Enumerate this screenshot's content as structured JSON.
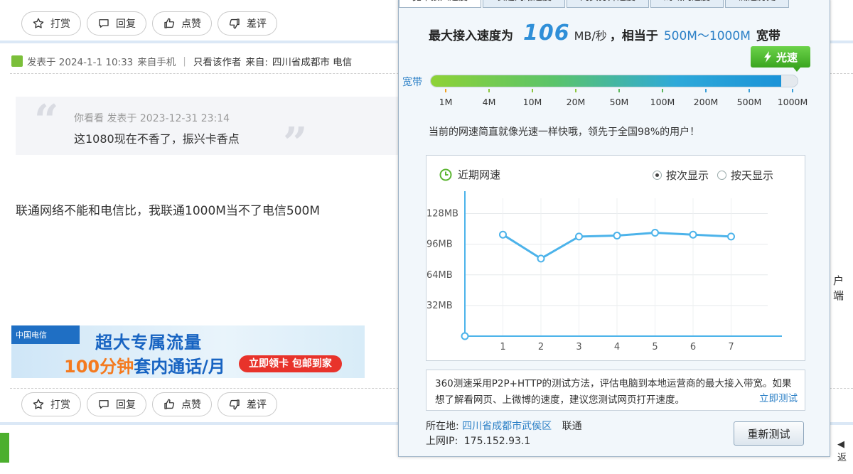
{
  "forum": {
    "action_buttons": [
      {
        "label": "打赏",
        "icon": "star-icon"
      },
      {
        "label": "回复",
        "icon": "comment-icon"
      },
      {
        "label": "点赞",
        "icon": "thumbs-up-icon"
      },
      {
        "label": "差评",
        "icon": "thumbs-down-icon"
      }
    ],
    "post_meta": {
      "posted_at": "发表于 2024-1-1 10:33",
      "from": "来自手机",
      "only_author": "只看该作者",
      "source_label": "来自:",
      "location": "四川省成都市 电信"
    },
    "quote": {
      "meta": "你看看 发表于 2023-12-31 23:14",
      "text": "这1080现在不香了，振兴卡香点"
    },
    "reply_text": "联通网络不能和电信比，我联通1000M当不了电信500M",
    "ad": {
      "logo": "中国电信",
      "line1": "超大专属流量",
      "line2_hl": "100分钟",
      "line2": "套内通话/月",
      "button": "立即领卡 包邮到家"
    },
    "right_cut_text": "户端",
    "right_cut_btn": "◀返"
  },
  "speedtest": {
    "tabs": [
      "宽带接入速度",
      "长途网络速度",
      "网页打开速度",
      "局域网速度",
      "测速历史"
    ],
    "headline": {
      "prefix": "最大接入速度为",
      "value": "106",
      "unit": "MB/秒",
      "mid": "，相当于",
      "range": "500M～1000M",
      "suffix": "宽带"
    },
    "badge": "光速",
    "bar_label": "宽带",
    "bar_fill_fraction": 0.955,
    "bar_ticks": [
      "1M",
      "4M",
      "10M",
      "20M",
      "50M",
      "100M",
      "200M",
      "500M",
      "1000M"
    ],
    "tick_colors": [
      "#f0a020",
      "#8cc63f",
      "#8cc63f",
      "#8cc63f",
      "#5cb85c",
      "#5cb85c",
      "#3a9fd8",
      "#3a9fd8",
      "#3a9fd8"
    ],
    "praise": "当前的网速简直就像光速一样快哦，领先于全国98%的用户！",
    "chart_title": "近期网速",
    "radio_options": [
      {
        "label": "按次显示",
        "selected": true
      },
      {
        "label": "按天显示",
        "selected": false
      }
    ],
    "info_text": "360测速采用P2P+HTTP的测试方法，评估电脑到本地运营商的最大接入带宽。如果想了解看网页、上微博的速度，建议您测试网页打开速度。",
    "info_link": "立即测试",
    "location_label": "所在地:",
    "location_value": "四川省成都市武侯区",
    "isp": "联通",
    "ip_label": "上网IP:",
    "ip_value": "175.152.93.1",
    "retest_button": "重新测试"
  },
  "chart_data": {
    "type": "line",
    "title": "近期网速",
    "x": [
      1,
      2,
      3,
      4,
      5,
      6,
      7
    ],
    "y_ticks": [
      "32MB",
      "64MB",
      "96MB",
      "128MB"
    ],
    "ylim": [
      0,
      144
    ],
    "series": [
      {
        "values": [
          106,
          81,
          104,
          105,
          108,
          106,
          104
        ]
      }
    ],
    "grid": true,
    "color": "#4cb3ea"
  }
}
